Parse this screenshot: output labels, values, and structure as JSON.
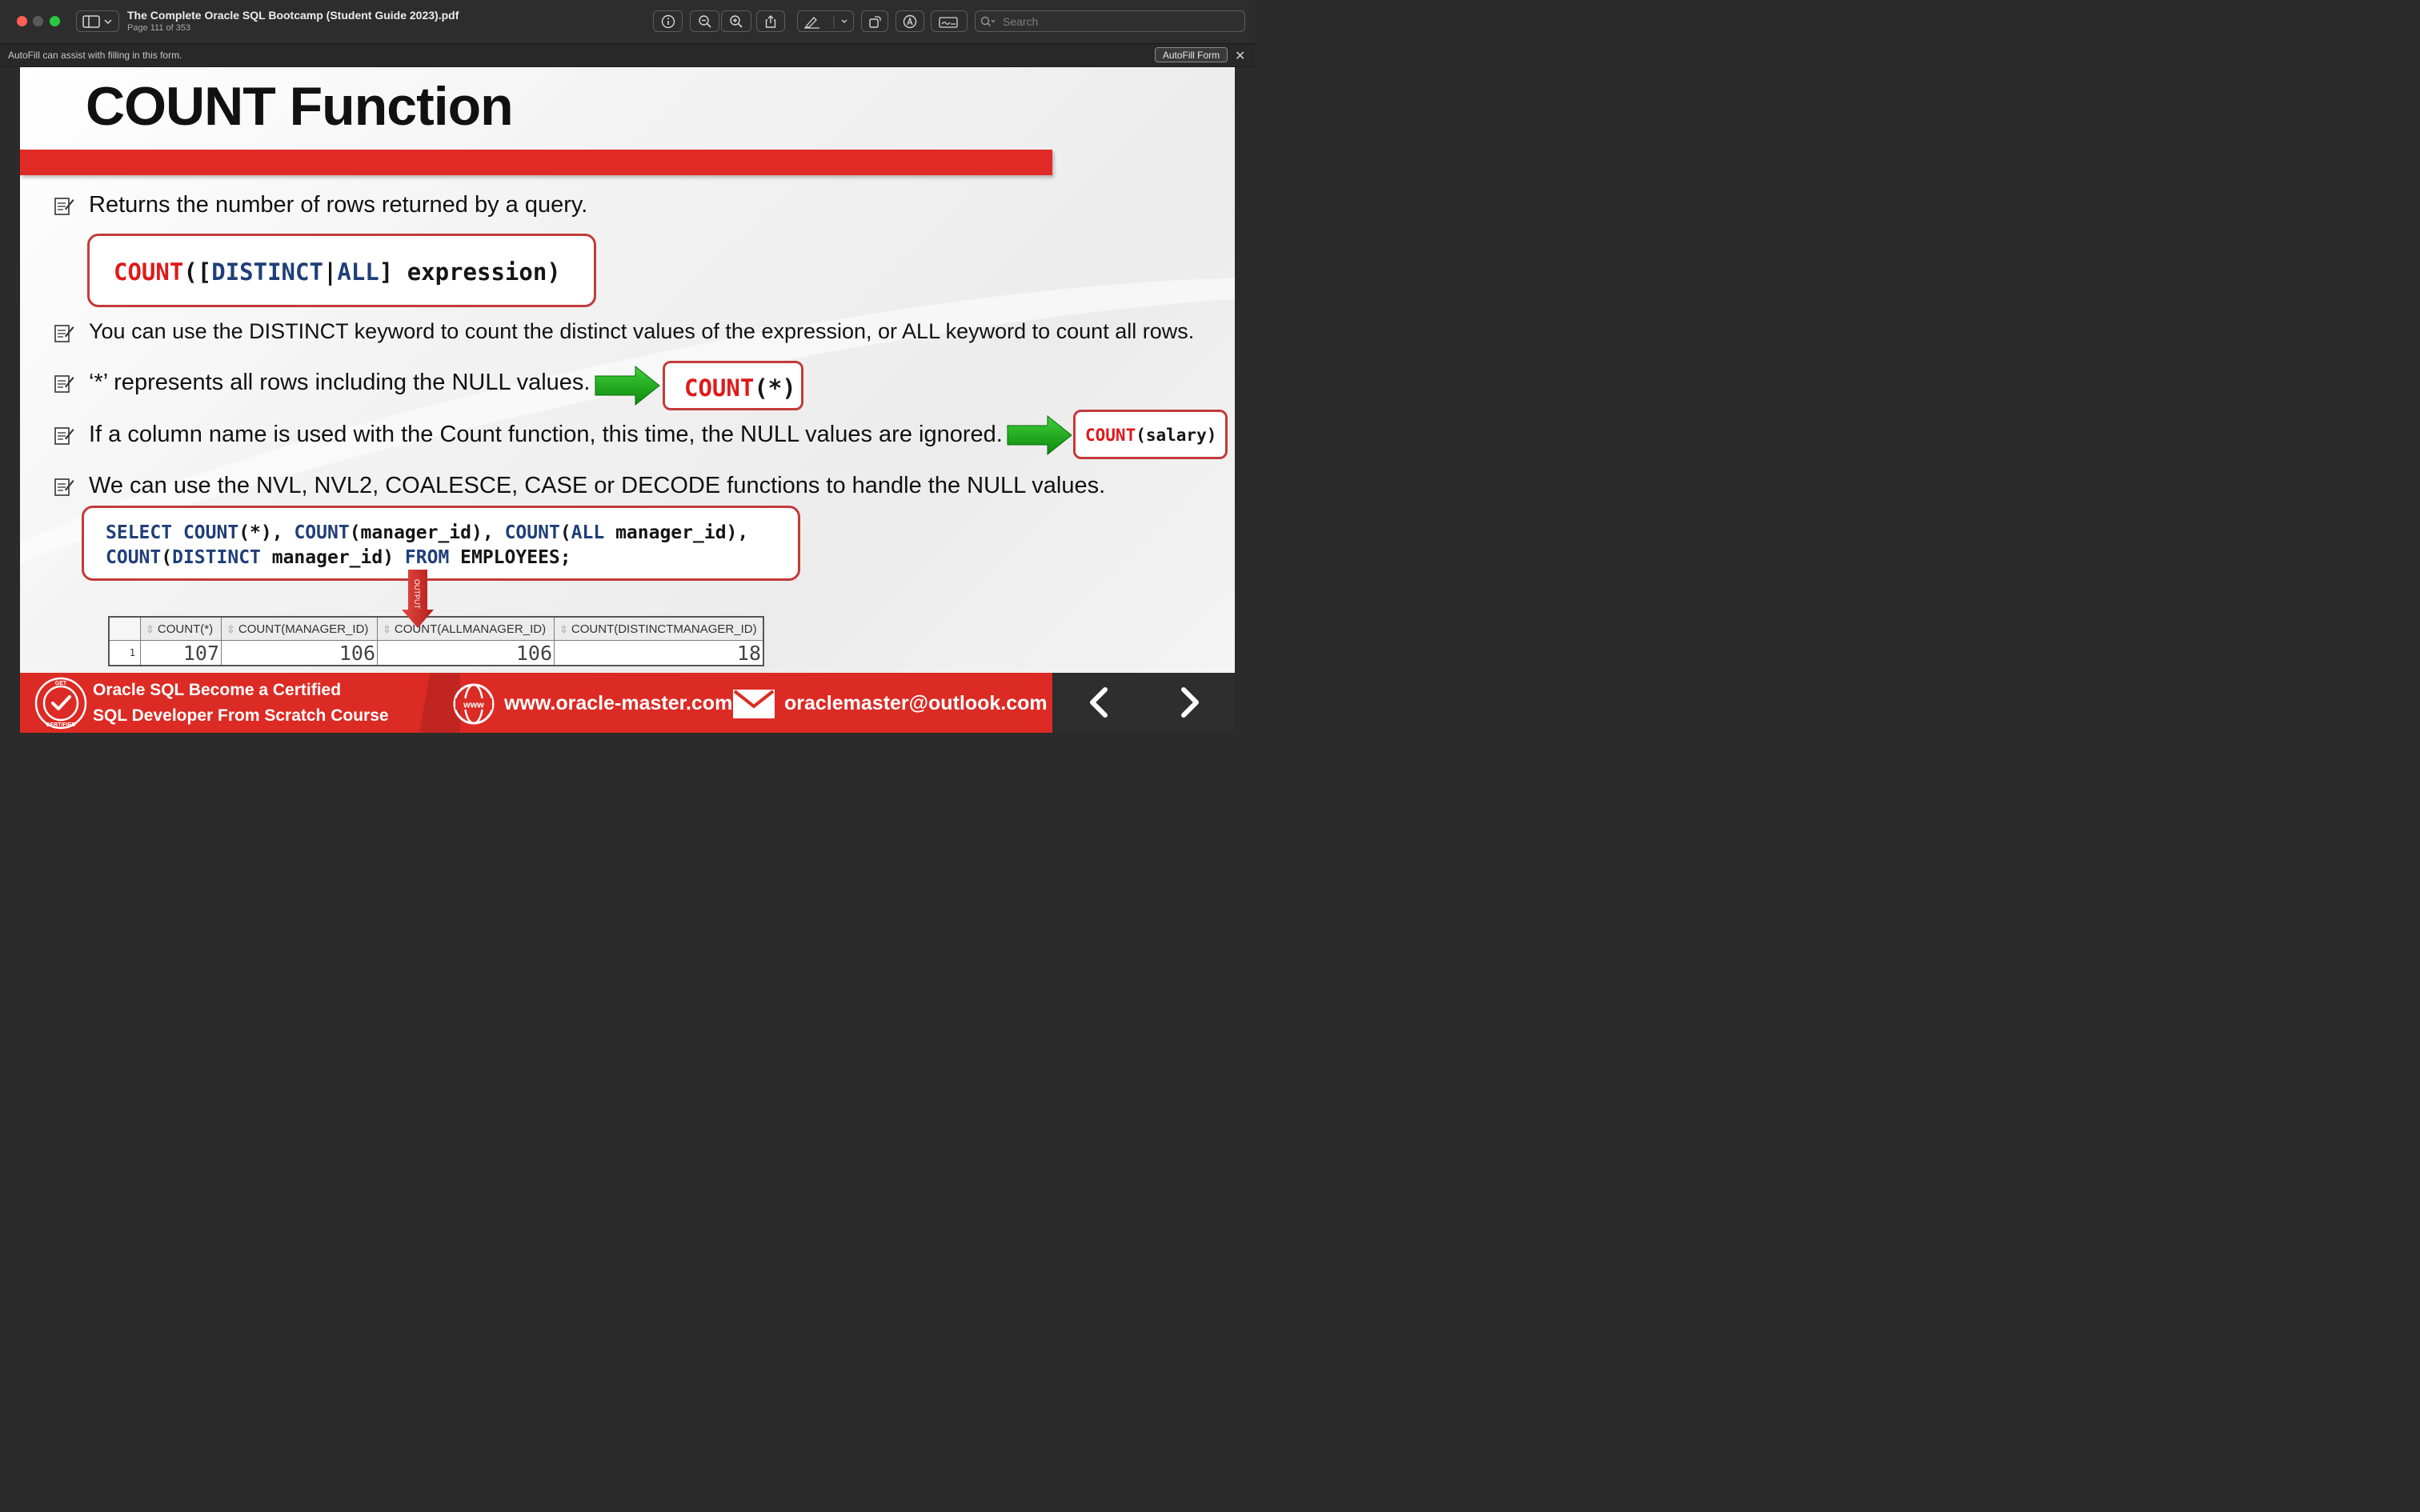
{
  "window": {
    "doc_title": "The Complete Oracle SQL Bootcamp (Student Guide 2023).pdf",
    "page_info": "Page 111 of 353",
    "search_placeholder": "Search"
  },
  "autofill": {
    "message": "AutoFill can assist with filling in this form.",
    "button_label": "AutoFill Form"
  },
  "slide": {
    "title": "COUNT Function",
    "bullets": [
      "Returns the number of rows returned by a query.",
      "You can use the DISTINCT keyword to count the distinct values of the expression, or ALL keyword to count all rows.",
      "‘*’ represents all rows including the NULL values.",
      "If a column name is used with the Count function, this time, the NULL values are ignored.",
      "We can use the NVL, NVL2, COALESCE, CASE or DECODE functions to handle the NULL values."
    ],
    "syntax": {
      "fn": "COUNT",
      "open": "([",
      "distinct": "DISTINCT",
      "sep": "|",
      "all": "ALL",
      "rest": "] expression)"
    },
    "count_star": {
      "fn": "COUNT",
      "args": "(*)"
    },
    "count_salary": {
      "fn": "COUNT",
      "args": "(salary)"
    },
    "query": {
      "l1_select": "SELECT ",
      "l1_c1": "COUNT",
      "l1_a1": "(*), ",
      "l1_c2": "COUNT",
      "l1_a2": "(manager_id), ",
      "l1_c3": "COUNT",
      "l1_a3open": "(",
      "l1_all": "ALL",
      "l1_a3": " manager_id),",
      "l2_c4": "COUNT",
      "l2_open": "(",
      "l2_distinct": "DISTINCT",
      "l2_a4": " manager_id) ",
      "l2_from": "FROM",
      "l2_tbl": " EMPLOYEES;"
    },
    "output_label": "OUTPUT",
    "result": {
      "columns": [
        "COUNT(*)",
        "COUNT(MANAGER_ID)",
        "COUNT(ALLMANAGER_ID)",
        "COUNT(DISTINCTMANAGER_ID)"
      ],
      "row_number": "1",
      "values": [
        "107",
        "106",
        "106",
        "18"
      ]
    },
    "footer": {
      "course_line1": "Oracle SQL Become a Certified",
      "course_line2": "SQL  Developer  From Scratch Course",
      "website": "www.oracle-master.com",
      "email": "oraclemaster@outlook.com",
      "badge_top": "GET",
      "badge_bottom": "CERTIFIED",
      "www_label": "www"
    }
  },
  "colors": {
    "accent_red": "#e12a26",
    "keyword_red": "#e0191a",
    "keyword_blue": "#1f3f78",
    "arrow_green": "#17a317"
  }
}
